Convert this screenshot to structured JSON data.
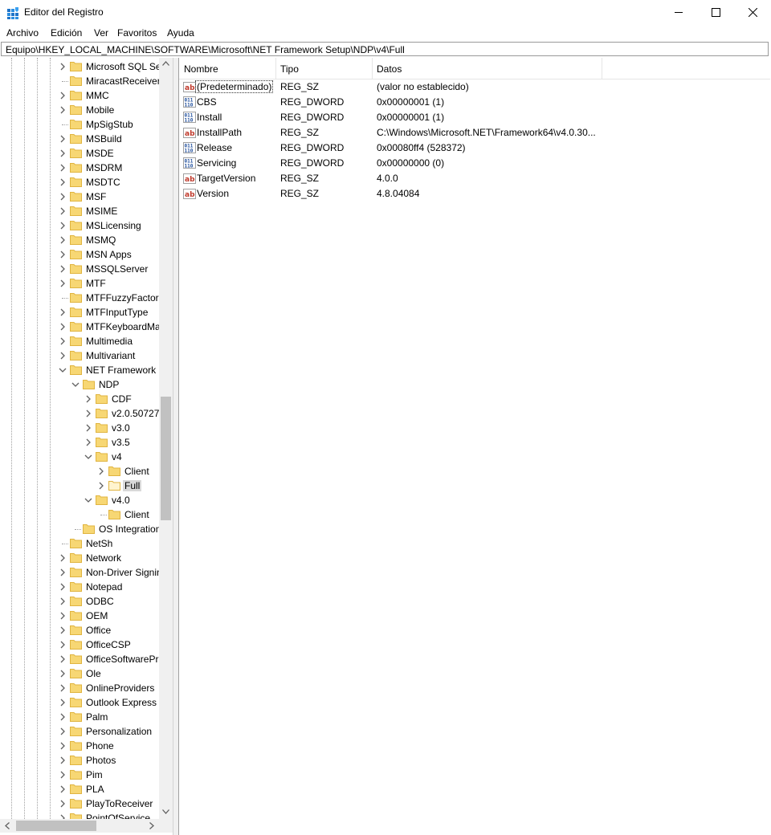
{
  "window": {
    "title": "Editor del Registro"
  },
  "menu": [
    "Archivo",
    "Edición",
    "Ver",
    "Favoritos",
    "Ayuda"
  ],
  "address": "Equipo\\HKEY_LOCAL_MACHINE\\SOFTWARE\\Microsoft\\NET Framework Setup\\NDP\\v4\\Full",
  "tree": [
    {
      "label": "Microsoft SQL Se",
      "level": 0,
      "chevron": "right"
    },
    {
      "label": "MiracastReceiver",
      "level": 0,
      "chevron": "none"
    },
    {
      "label": "MMC",
      "level": 0,
      "chevron": "right"
    },
    {
      "label": "Mobile",
      "level": 0,
      "chevron": "right"
    },
    {
      "label": "MpSigStub",
      "level": 0,
      "chevron": "none"
    },
    {
      "label": "MSBuild",
      "level": 0,
      "chevron": "right"
    },
    {
      "label": "MSDE",
      "level": 0,
      "chevron": "right"
    },
    {
      "label": "MSDRM",
      "level": 0,
      "chevron": "right"
    },
    {
      "label": "MSDTC",
      "level": 0,
      "chevron": "right"
    },
    {
      "label": "MSF",
      "level": 0,
      "chevron": "right"
    },
    {
      "label": "MSIME",
      "level": 0,
      "chevron": "right"
    },
    {
      "label": "MSLicensing",
      "level": 0,
      "chevron": "right"
    },
    {
      "label": "MSMQ",
      "level": 0,
      "chevron": "right"
    },
    {
      "label": "MSN Apps",
      "level": 0,
      "chevron": "right"
    },
    {
      "label": "MSSQLServer",
      "level": 0,
      "chevron": "right"
    },
    {
      "label": "MTF",
      "level": 0,
      "chevron": "right"
    },
    {
      "label": "MTFFuzzyFactors",
      "level": 0,
      "chevron": "none"
    },
    {
      "label": "MTFInputType",
      "level": 0,
      "chevron": "right"
    },
    {
      "label": "MTFKeyboardMa",
      "level": 0,
      "chevron": "right"
    },
    {
      "label": "Multimedia",
      "level": 0,
      "chevron": "right"
    },
    {
      "label": "Multivariant",
      "level": 0,
      "chevron": "right"
    },
    {
      "label": "NET Framework S",
      "level": 0,
      "chevron": "down"
    },
    {
      "label": "NDP",
      "level": 1,
      "chevron": "down"
    },
    {
      "label": "CDF",
      "level": 2,
      "chevron": "right"
    },
    {
      "label": "v2.0.50727",
      "level": 2,
      "chevron": "right"
    },
    {
      "label": "v3.0",
      "level": 2,
      "chevron": "right"
    },
    {
      "label": "v3.5",
      "level": 2,
      "chevron": "right"
    },
    {
      "label": "v4",
      "level": 2,
      "chevron": "down"
    },
    {
      "label": "Client",
      "level": 3,
      "chevron": "right"
    },
    {
      "label": "Full",
      "level": 3,
      "chevron": "right",
      "selected": true
    },
    {
      "label": "v4.0",
      "level": 2,
      "chevron": "down"
    },
    {
      "label": "Client",
      "level": 3,
      "chevron": "none"
    },
    {
      "label": "OS Integration",
      "level": 1,
      "chevron": "none"
    },
    {
      "label": "NetSh",
      "level": 0,
      "chevron": "none"
    },
    {
      "label": "Network",
      "level": 0,
      "chevron": "right"
    },
    {
      "label": "Non-Driver Signin",
      "level": 0,
      "chevron": "right"
    },
    {
      "label": "Notepad",
      "level": 0,
      "chevron": "right"
    },
    {
      "label": "ODBC",
      "level": 0,
      "chevron": "right"
    },
    {
      "label": "OEM",
      "level": 0,
      "chevron": "right"
    },
    {
      "label": "Office",
      "level": 0,
      "chevron": "right"
    },
    {
      "label": "OfficeCSP",
      "level": 0,
      "chevron": "right"
    },
    {
      "label": "OfficeSoftwarePr",
      "level": 0,
      "chevron": "right"
    },
    {
      "label": "Ole",
      "level": 0,
      "chevron": "right"
    },
    {
      "label": "OnlineProviders",
      "level": 0,
      "chevron": "right"
    },
    {
      "label": "Outlook Express",
      "level": 0,
      "chevron": "right"
    },
    {
      "label": "Palm",
      "level": 0,
      "chevron": "right"
    },
    {
      "label": "Personalization",
      "level": 0,
      "chevron": "right"
    },
    {
      "label": "Phone",
      "level": 0,
      "chevron": "right"
    },
    {
      "label": "Photos",
      "level": 0,
      "chevron": "right"
    },
    {
      "label": "Pim",
      "level": 0,
      "chevron": "right"
    },
    {
      "label": "PLA",
      "level": 0,
      "chevron": "right"
    },
    {
      "label": "PlayToReceiver",
      "level": 0,
      "chevron": "right"
    },
    {
      "label": "PointOfService",
      "level": 0,
      "chevron": "right"
    }
  ],
  "columns": [
    "Nombre",
    "Tipo",
    "Datos"
  ],
  "values": [
    {
      "name": "(Predeterminado)",
      "type": "REG_SZ",
      "data": "(valor no establecido)",
      "icon": "string-value-icon"
    },
    {
      "name": "CBS",
      "type": "REG_DWORD",
      "data": "0x00000001 (1)",
      "icon": "binary-value-icon"
    },
    {
      "name": "Install",
      "type": "REG_DWORD",
      "data": "0x00000001 (1)",
      "icon": "binary-value-icon"
    },
    {
      "name": "InstallPath",
      "type": "REG_SZ",
      "data": "C:\\Windows\\Microsoft.NET\\Framework64\\v4.0.30...",
      "icon": "string-value-icon"
    },
    {
      "name": "Release",
      "type": "REG_DWORD",
      "data": "0x00080ff4 (528372)",
      "icon": "binary-value-icon"
    },
    {
      "name": "Servicing",
      "type": "REG_DWORD",
      "data": "0x00000000 (0)",
      "icon": "binary-value-icon"
    },
    {
      "name": "TargetVersion",
      "type": "REG_SZ",
      "data": "4.0.0",
      "icon": "string-value-icon"
    },
    {
      "name": "Version",
      "type": "REG_SZ",
      "data": "4.8.04084",
      "icon": "string-value-icon"
    }
  ],
  "colors": {
    "folder": "#f7d774",
    "folder_dark": "#e0b440",
    "string_icon": "#c0392b",
    "binary_icon": "#1f4e9c",
    "selection": "#d9d9d9"
  }
}
